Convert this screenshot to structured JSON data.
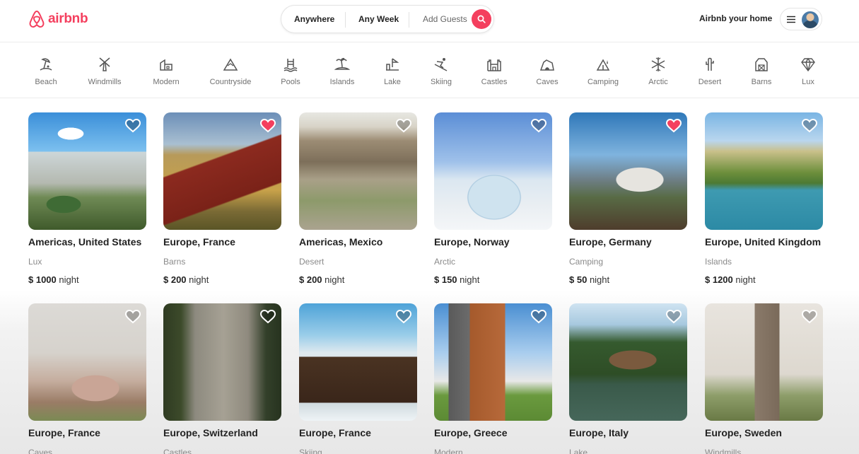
{
  "brand": {
    "name": "airbnb",
    "color": "#f43f5e"
  },
  "search": {
    "where": "Anywhere",
    "when": "Any Week",
    "guests": "Add Guests"
  },
  "header": {
    "host_link": "Airbnb your home"
  },
  "categories": [
    {
      "label": "Beach",
      "icon": "beach-icon"
    },
    {
      "label": "Windmills",
      "icon": "windmill-icon"
    },
    {
      "label": "Modern",
      "icon": "modern-house-icon"
    },
    {
      "label": "Countryside",
      "icon": "mountain-icon"
    },
    {
      "label": "Pools",
      "icon": "pool-icon"
    },
    {
      "label": "Islands",
      "icon": "island-icon"
    },
    {
      "label": "Lake",
      "icon": "lake-icon"
    },
    {
      "label": "Skiing",
      "icon": "skiing-icon"
    },
    {
      "label": "Castles",
      "icon": "castle-icon"
    },
    {
      "label": "Caves",
      "icon": "cave-icon"
    },
    {
      "label": "Camping",
      "icon": "tent-icon"
    },
    {
      "label": "Arctic",
      "icon": "snowflake-icon"
    },
    {
      "label": "Desert",
      "icon": "cactus-icon"
    },
    {
      "label": "Barns",
      "icon": "barn-icon"
    },
    {
      "label": "Lux",
      "icon": "diamond-icon"
    }
  ],
  "listings": [
    {
      "location": "Americas, United States",
      "category": "Lux",
      "price": "$ 1000",
      "unit": "night",
      "favorite": false
    },
    {
      "location": "Europe, France",
      "category": "Barns",
      "price": "$ 200",
      "unit": "night",
      "favorite": true
    },
    {
      "location": "Americas, Mexico",
      "category": "Desert",
      "price": "$ 200",
      "unit": "night",
      "favorite": false
    },
    {
      "location": "Europe, Norway",
      "category": "Arctic",
      "price": "$ 150",
      "unit": "night",
      "favorite": false
    },
    {
      "location": "Europe, Germany",
      "category": "Camping",
      "price": "$ 50",
      "unit": "night",
      "favorite": true
    },
    {
      "location": "Europe, United Kingdom",
      "category": "Islands",
      "price": "$ 1200",
      "unit": "night",
      "favorite": false
    },
    {
      "location": "Europe, France",
      "category": "Caves",
      "favorite": false
    },
    {
      "location": "Europe, Switzerland",
      "category": "Castles",
      "favorite": false
    },
    {
      "location": "Europe, France",
      "category": "Skiing",
      "favorite": false
    },
    {
      "location": "Europe, Greece",
      "category": "Modern",
      "favorite": false
    },
    {
      "location": "Europe, Italy",
      "category": "Lake",
      "favorite": false
    },
    {
      "location": "Europe, Sweden",
      "category": "Windmills",
      "favorite": false
    }
  ]
}
